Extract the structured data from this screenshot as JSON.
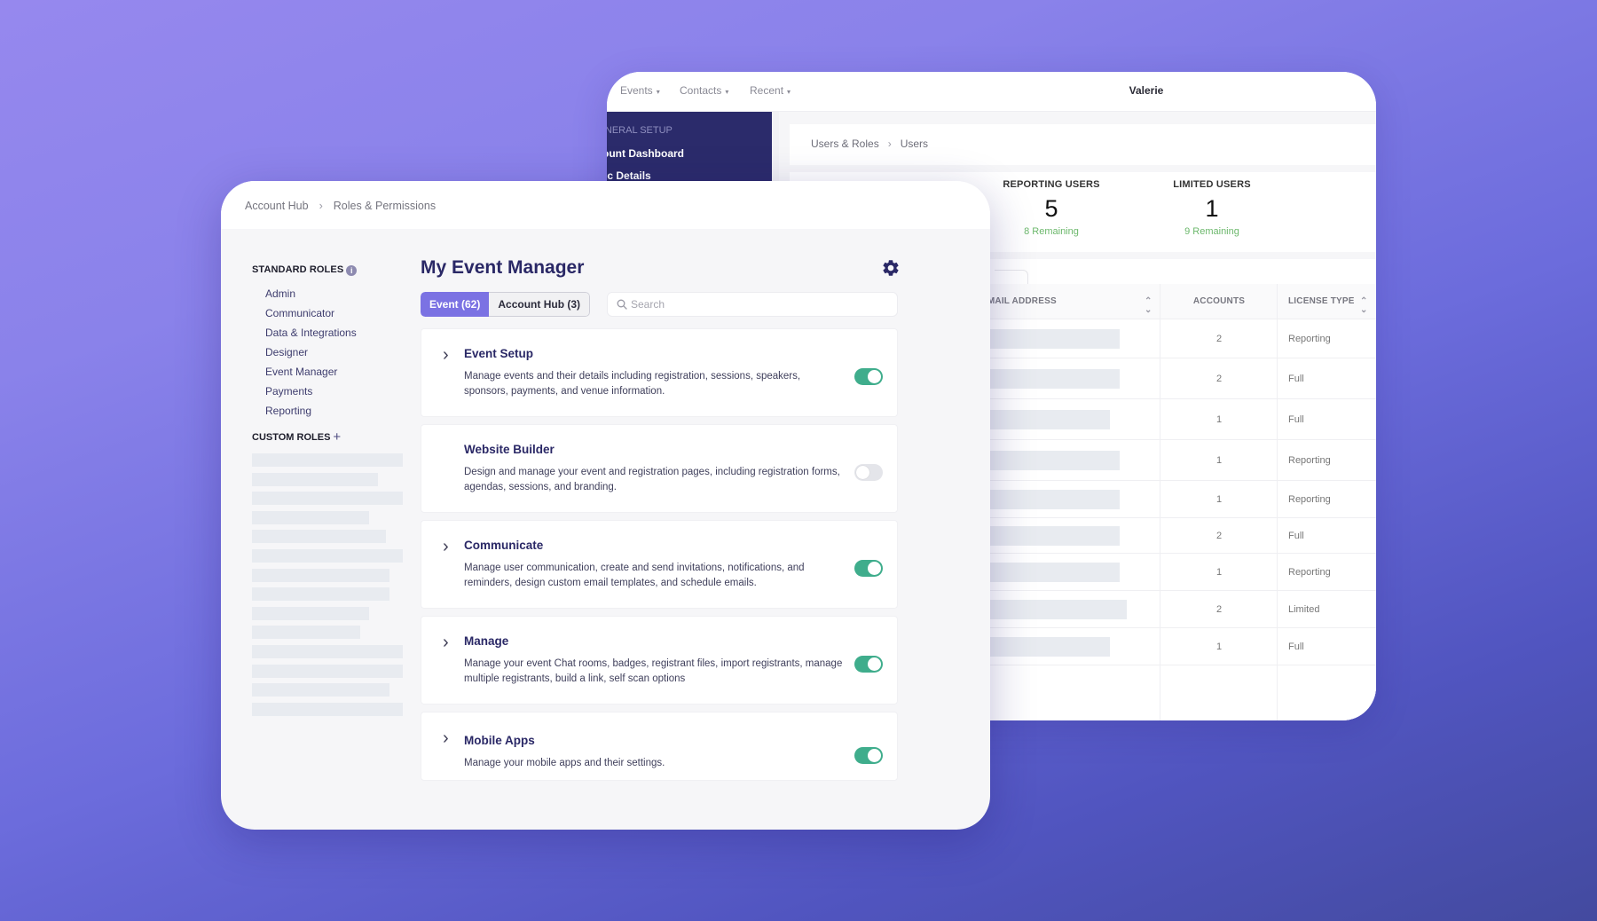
{
  "back_window": {
    "nav": [
      {
        "label": "Events"
      },
      {
        "label": "Contacts"
      },
      {
        "label": "Recent"
      }
    ],
    "user_name": "Valerie",
    "sidebar": {
      "section_label": "GENERAL SETUP",
      "links": [
        "Account Dashboard",
        "Basic Details"
      ]
    },
    "breadcrumb": [
      "Users & Roles",
      "Users"
    ],
    "stats": [
      {
        "label": "REPORTING USERS",
        "value": "5",
        "remaining": "8 Remaining"
      },
      {
        "label": "LIMITED USERS",
        "value": "1",
        "remaining": "9 Remaining"
      }
    ],
    "table": {
      "columns": [
        "EMAIL ADDRESS",
        "ACCOUNTS",
        "LICENSE TYPE"
      ],
      "rows": [
        {
          "accounts": "2",
          "license": "Reporting"
        },
        {
          "accounts": "2",
          "license": "Full"
        },
        {
          "accounts": "1",
          "license": "Full"
        },
        {
          "accounts": "1",
          "license": "Reporting"
        },
        {
          "accounts": "1",
          "license": "Reporting"
        },
        {
          "accounts": "2",
          "license": "Full"
        },
        {
          "accounts": "1",
          "license": "Reporting"
        },
        {
          "accounts": "2",
          "license": "Limited"
        },
        {
          "accounts": "1",
          "license": "Full"
        }
      ]
    }
  },
  "front_window": {
    "breadcrumb": [
      "Account Hub",
      "Roles & Permissions"
    ],
    "standard_roles": {
      "heading": "STANDARD ROLES",
      "info_icon": "i",
      "items": [
        "Admin",
        "Communicator",
        "Data & Integrations",
        "Designer",
        "Event Manager",
        "Payments",
        "Reporting"
      ]
    },
    "custom_roles": {
      "heading": "CUSTOM ROLES",
      "add_icon": "+"
    },
    "main": {
      "title": "My Event Manager",
      "tabs": [
        {
          "label": "Event (62)",
          "active": true
        },
        {
          "label": "Account Hub (3)",
          "active": false
        }
      ],
      "search": {
        "placeholder": "Search",
        "value": ""
      },
      "permissions": [
        {
          "title": "Event Setup",
          "description": "Manage events and their details including registration, sessions, speakers, sponsors, payments, and venue information.",
          "expandable": true,
          "enabled": true
        },
        {
          "title": "Website Builder",
          "description": "Design and manage your event and registration pages, including registration forms, agendas, sessions, and branding.",
          "expandable": false,
          "enabled": false
        },
        {
          "title": "Communicate",
          "description": "Manage user communication, create and send invitations, notifications, and reminders, design custom email templates, and schedule emails.",
          "expandable": true,
          "enabled": true
        },
        {
          "title": "Manage",
          "description": "Manage your event Chat rooms, badges, registrant files, import registrants, manage multiple registrants, build a link, self scan options",
          "expandable": true,
          "enabled": true
        },
        {
          "title": "Mobile Apps",
          "description": "Manage your mobile apps and their settings.",
          "expandable": true,
          "enabled": true
        }
      ]
    }
  },
  "colors": {
    "accent": "#7b72e3",
    "toggle_on": "#3fad8c",
    "toggle_off": "#e4e5ea",
    "title_navy": "#2a2866",
    "sidebar_dark": "#2b2b6b",
    "remaining_green": "#6cb86c"
  }
}
